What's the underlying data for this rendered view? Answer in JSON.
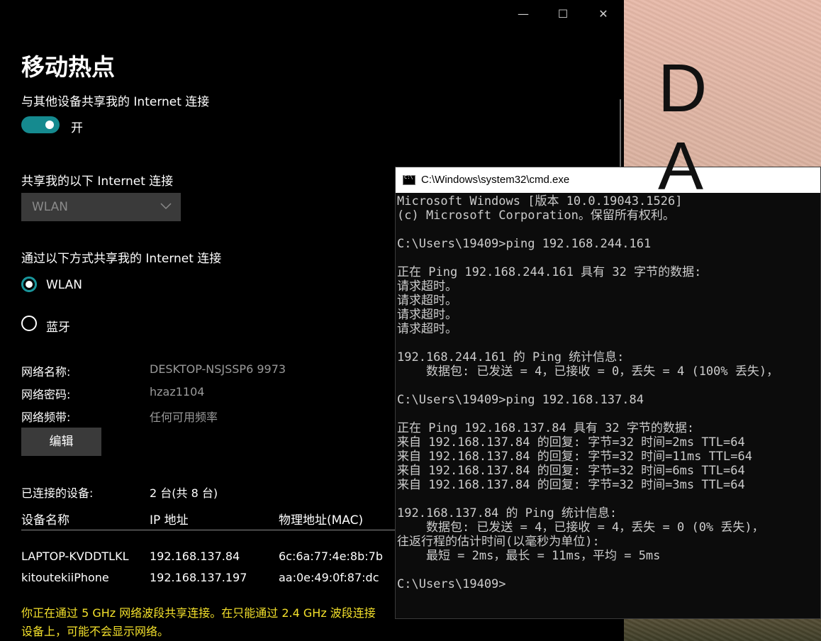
{
  "background": {
    "letters": "D A"
  },
  "window_controls": {
    "minimize": "—",
    "maximize": "☐",
    "close": "✕"
  },
  "hotspot": {
    "title": "移动热点",
    "share_label": "与其他设备共享我的 Internet 连接",
    "toggle_state": "开",
    "share_from_label": "共享我的以下 Internet 连接",
    "share_from_value": "WLAN",
    "share_over_label": "通过以下方式共享我的 Internet 连接",
    "options": [
      {
        "label": "WLAN",
        "selected": true
      },
      {
        "label": "蓝牙",
        "selected": false
      }
    ],
    "network_name_key": "网络名称:",
    "network_name": "DESKTOP-NSJSSP6 9973",
    "network_password_key": "网络密码:",
    "network_password": "hzaz1104",
    "network_band_key": "网络频带:",
    "network_band": "任何可用频率",
    "edit_button": "编辑",
    "connected_key": "已连接的设备:",
    "connected_value": "2 台(共 8 台)",
    "table": {
      "headers": [
        "设备名称",
        "IP 地址",
        "物理地址(MAC)"
      ],
      "rows": [
        [
          "LAPTOP-KVDDTLKL",
          "192.168.137.84",
          "6c:6a:77:4e:8b:7b"
        ],
        [
          "kitoutekiiPhone",
          "192.168.137.197",
          "aa:0e:49:0f:87:dc"
        ]
      ]
    },
    "notice_line1": "你正在通过 5 GHz 网络波段共享连接。在只能通过 2.4 GHz 波段连接",
    "notice_line2": "设备上，可能不会显示网络。",
    "accent_color": "#158a8f",
    "notice_color": "#f3e02b"
  },
  "cmd": {
    "title": "C:\\Windows\\system32\\cmd.exe",
    "lines": [
      "Microsoft Windows [版本 10.0.19043.1526]",
      "(c) Microsoft Corporation。保留所有权利。",
      "",
      "C:\\Users\\19409>ping 192.168.244.161",
      "",
      "正在 Ping 192.168.244.161 具有 32 字节的数据:",
      "请求超时。",
      "请求超时。",
      "请求超时。",
      "请求超时。",
      "",
      "192.168.244.161 的 Ping 统计信息:",
      "    数据包: 已发送 = 4，已接收 = 0，丢失 = 4 (100% 丢失)，",
      "",
      "C:\\Users\\19409>ping 192.168.137.84",
      "",
      "正在 Ping 192.168.137.84 具有 32 字节的数据:",
      "来自 192.168.137.84 的回复: 字节=32 时间=2ms TTL=64",
      "来自 192.168.137.84 的回复: 字节=32 时间=11ms TTL=64",
      "来自 192.168.137.84 的回复: 字节=32 时间=6ms TTL=64",
      "来自 192.168.137.84 的回复: 字节=32 时间=3ms TTL=64",
      "",
      "192.168.137.84 的 Ping 统计信息:",
      "    数据包: 已发送 = 4，已接收 = 4，丢失 = 0 (0% 丢失)，",
      "往返行程的估计时间(以毫秒为单位):",
      "    最短 = 2ms，最长 = 11ms，平均 = 5ms",
      "",
      "C:\\Users\\19409>"
    ]
  }
}
